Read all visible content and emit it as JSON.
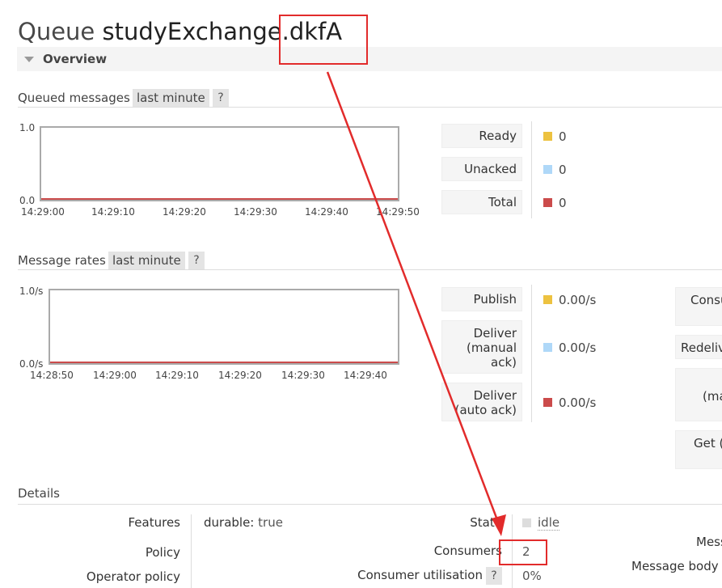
{
  "page": {
    "title_prefix": "Queue",
    "queue_name": "studyExchange.dkfA"
  },
  "overview": {
    "label": "Overview"
  },
  "queued_messages": {
    "title": "Queued messages",
    "range": "last minute",
    "help": "?",
    "y_ticks": [
      "1.0",
      "0.0"
    ],
    "x_ticks": [
      "14:29:00",
      "14:29:10",
      "14:29:20",
      "14:29:30",
      "14:29:40",
      "14:29:50"
    ],
    "stats": [
      {
        "label": "Ready",
        "value": "0",
        "color": "#edc240"
      },
      {
        "label": "Unacked",
        "value": "0",
        "color": "#afd8f8"
      },
      {
        "label": "Total",
        "value": "0",
        "color": "#cb4b4b"
      }
    ]
  },
  "message_rates": {
    "title": "Message rates",
    "range": "last minute",
    "help": "?",
    "y_ticks": [
      "1.0/s",
      "0.0/s"
    ],
    "x_ticks": [
      "14:28:50",
      "14:29:00",
      "14:29:10",
      "14:29:20",
      "14:29:30",
      "14:29:40"
    ],
    "stats": [
      {
        "label": "Publish",
        "value": "0.00/s",
        "color": "#edc240"
      },
      {
        "label_lines": [
          "Deliver",
          "(manual",
          "ack)"
        ],
        "value": "0.00/s",
        "color": "#afd8f8"
      },
      {
        "label_lines": [
          "Deliver",
          "(auto ack)"
        ],
        "value": "0.00/s",
        "color": "#cb4b4b"
      }
    ],
    "right_clipped": [
      "Consu",
      "Redeliv",
      "(ma",
      "Get ("
    ]
  },
  "chart_data": [
    {
      "type": "line",
      "title": "Queued messages",
      "x": [
        "14:29:00",
        "14:29:10",
        "14:29:20",
        "14:29:30",
        "14:29:40",
        "14:29:50"
      ],
      "ylim": [
        0,
        1
      ],
      "series": [
        {
          "name": "Ready",
          "values": [
            0,
            0,
            0,
            0,
            0,
            0
          ],
          "color": "#edc240"
        },
        {
          "name": "Unacked",
          "values": [
            0,
            0,
            0,
            0,
            0,
            0
          ],
          "color": "#afd8f8"
        },
        {
          "name": "Total",
          "values": [
            0,
            0,
            0,
            0,
            0,
            0
          ],
          "color": "#cb4b4b"
        }
      ]
    },
    {
      "type": "line",
      "title": "Message rates",
      "x": [
        "14:28:50",
        "14:29:00",
        "14:29:10",
        "14:29:20",
        "14:29:30",
        "14:29:40"
      ],
      "ylim": [
        0,
        1
      ],
      "series": [
        {
          "name": "Publish",
          "values": [
            0,
            0,
            0,
            0,
            0,
            0
          ],
          "color": "#edc240"
        },
        {
          "name": "Deliver (manual ack)",
          "values": [
            0,
            0,
            0,
            0,
            0,
            0
          ],
          "color": "#afd8f8"
        },
        {
          "name": "Deliver (auto ack)",
          "values": [
            0,
            0,
            0,
            0,
            0,
            0
          ],
          "color": "#cb4b4b"
        }
      ]
    }
  ],
  "details": {
    "title": "Details",
    "features_label": "Features",
    "features_key": "durable:",
    "features_value": "true",
    "policy_label": "Policy",
    "operator_policy_label": "Operator policy",
    "state_label": "State",
    "state_value": "idle",
    "consumers_label": "Consumers",
    "consumers_value": "2",
    "consumer_util_label": "Consumer utilisation",
    "consumer_util_help": "?",
    "consumer_util_value": "0%",
    "right_messages_label": "Mess",
    "right_body_label": "Message body"
  },
  "annotation": {
    "color": "#e22b2b"
  }
}
